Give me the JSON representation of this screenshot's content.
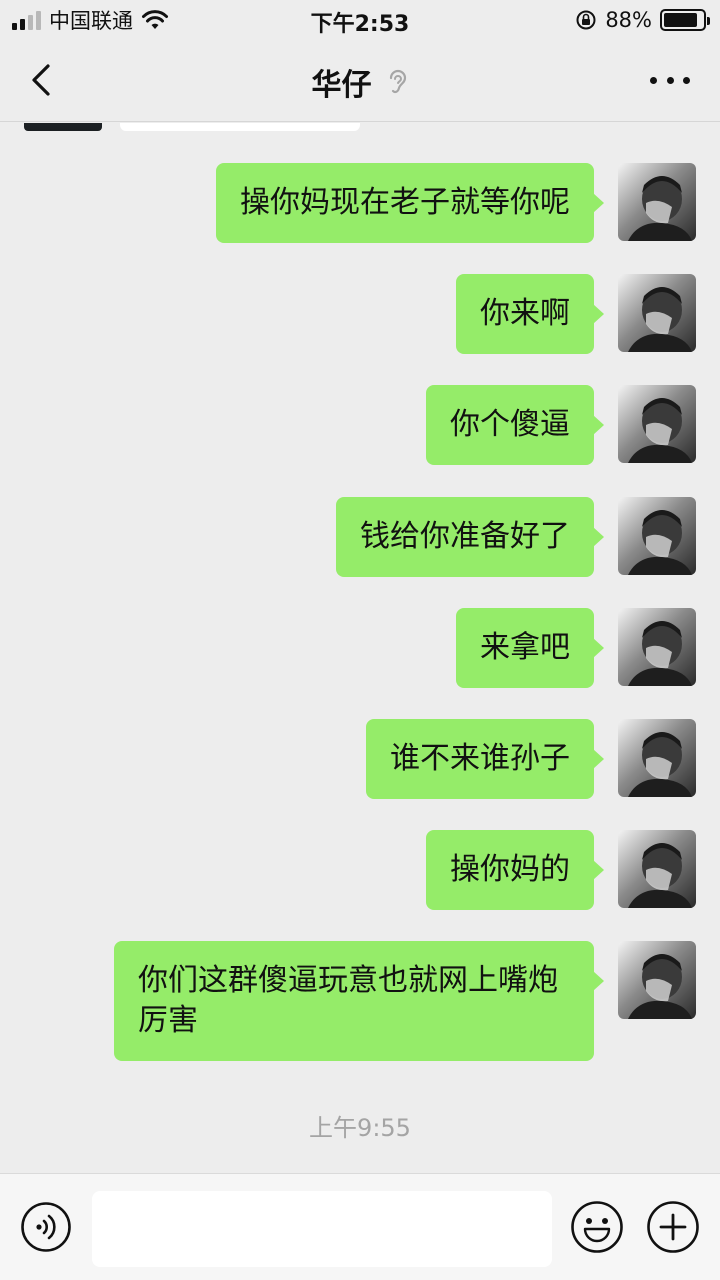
{
  "status_bar": {
    "carrier": "中国联通",
    "time": "下午2:53",
    "battery_percent": "88%",
    "battery_level": 0.88
  },
  "nav": {
    "title": "华仔",
    "back_icon": "chevron-left-icon",
    "more_icon": "more-dots-icon",
    "ear_icon": "ear-icon"
  },
  "messages": [
    {
      "text": "操你妈现在老子就等你呢"
    },
    {
      "text": "你来啊"
    },
    {
      "text": "你个傻逼"
    },
    {
      "text": "钱给你准备好了"
    },
    {
      "text": "来拿吧"
    },
    {
      "text": "谁不来谁孙子"
    },
    {
      "text": "操你妈的"
    },
    {
      "text": "你们这群傻逼玩意也就网上嘴炮厉害"
    }
  ],
  "timestamp": "上午9:55",
  "input_bar": {
    "voice_icon": "voice-icon",
    "emoji_icon": "emoji-icon",
    "plus_icon": "plus-icon",
    "value": ""
  },
  "colors": {
    "bubble": "#95ec69",
    "background": "#ededed",
    "input_bar": "#f6f6f6"
  }
}
